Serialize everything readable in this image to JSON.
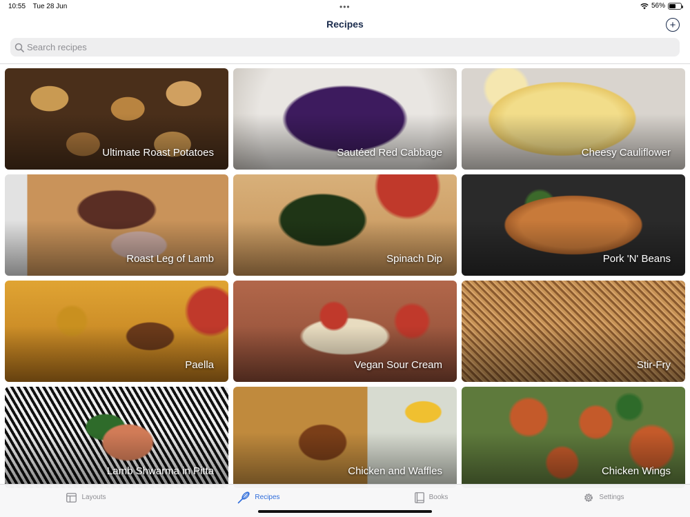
{
  "status_bar": {
    "time": "10:55",
    "date": "Tue 28 Jun",
    "battery_percent": "56%",
    "battery_level": 0.56
  },
  "nav": {
    "title": "Recipes",
    "add_icon": "plus-circle-icon"
  },
  "search": {
    "placeholder": "Search recipes",
    "value": ""
  },
  "recipes": [
    {
      "title": "Ultimate Roast Potatoes"
    },
    {
      "title": "Sautéed Red Cabbage"
    },
    {
      "title": "Cheesy Cauliflower"
    },
    {
      "title": "Roast Leg of Lamb"
    },
    {
      "title": "Spinach Dip"
    },
    {
      "title": "Pork 'N' Beans"
    },
    {
      "title": "Paella"
    },
    {
      "title": "Vegan Sour Cream"
    },
    {
      "title": "Stir-Fry"
    },
    {
      "title": "Lamb Shwarma in Pitta"
    },
    {
      "title": "Chicken and Waffles"
    },
    {
      "title": "Chicken Wings"
    }
  ],
  "tabs": [
    {
      "label": "Layouts",
      "icon": "layout-icon",
      "active": false
    },
    {
      "label": "Recipes",
      "icon": "whisk-icon",
      "active": true
    },
    {
      "label": "Books",
      "icon": "book-icon",
      "active": false
    },
    {
      "label": "Settings",
      "icon": "gear-icon",
      "active": false
    }
  ],
  "colors": {
    "accent": "#2f6ddb",
    "title": "#1a2b4c",
    "tab_inactive": "#8e8e93"
  }
}
